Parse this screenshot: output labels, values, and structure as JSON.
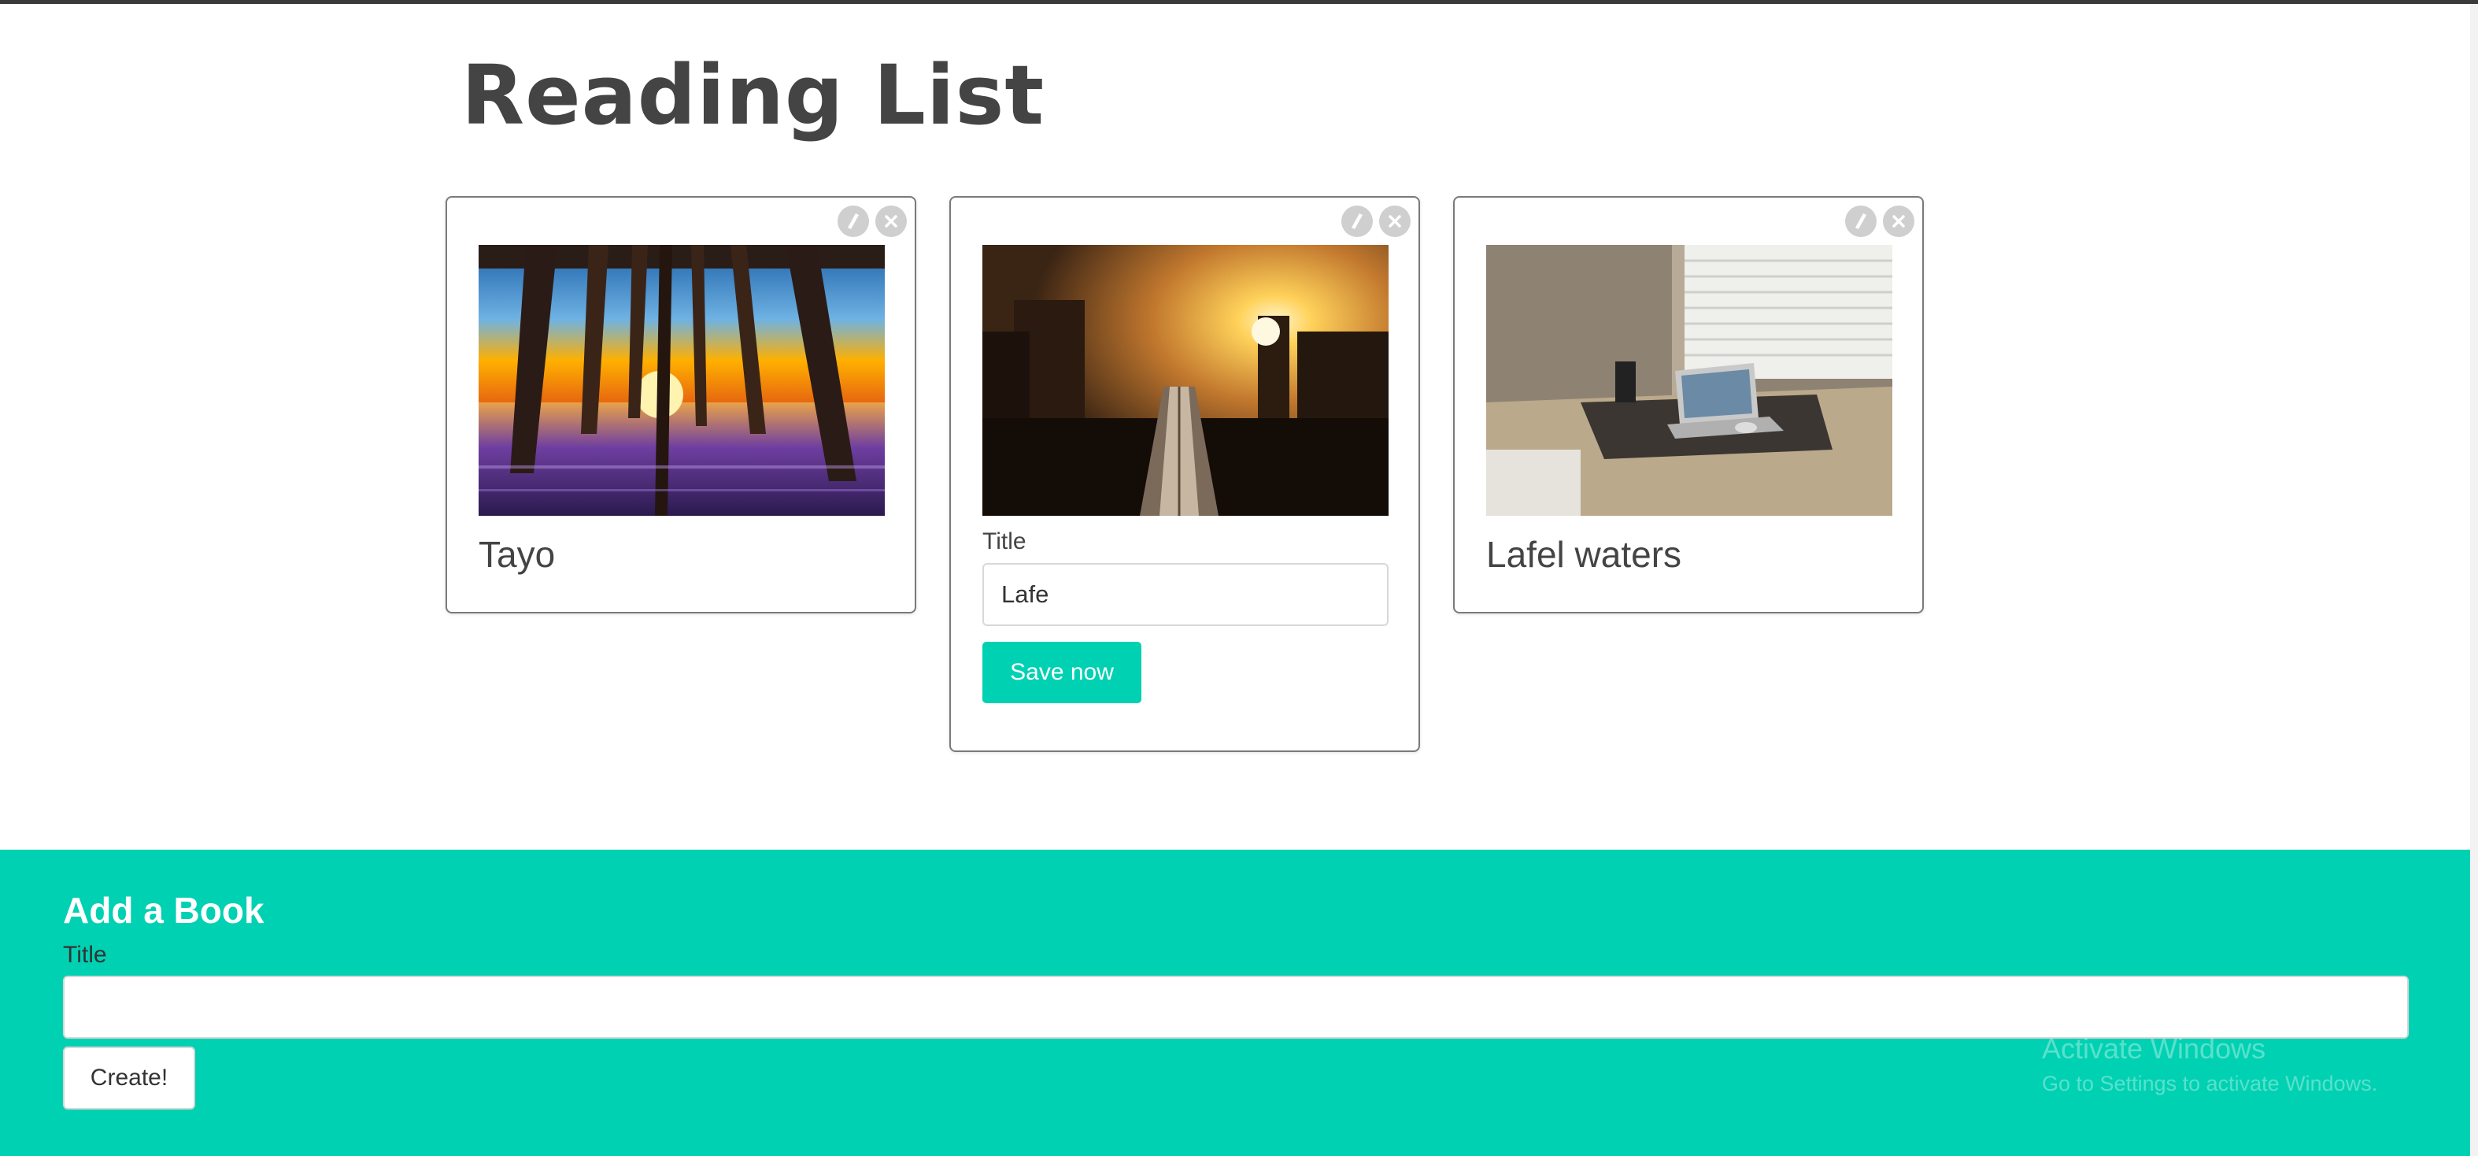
{
  "page": {
    "title": "Reading List"
  },
  "books": [
    {
      "title": "Tayo",
      "image": "pier at sunset"
    },
    {
      "title": "Lafe",
      "image": "city sunset over rail tracks",
      "editing": true
    },
    {
      "title": "Lafel waters",
      "image": "laptop on desk by window"
    }
  ],
  "edit_form": {
    "label": "Title",
    "value": "Lafe",
    "save_label": "Save now"
  },
  "add_form": {
    "heading": "Add a Book",
    "label": "Title",
    "value": "",
    "create_label": "Create!"
  },
  "watermark": {
    "title": "Activate Windows",
    "subtitle": "Go to Settings to activate Windows."
  },
  "colors": {
    "accent": "#00d1b2",
    "text": "#444444",
    "icon_bg": "#cfcfcf"
  },
  "icons": {
    "edit": "edit-icon",
    "delete": "close-icon"
  }
}
